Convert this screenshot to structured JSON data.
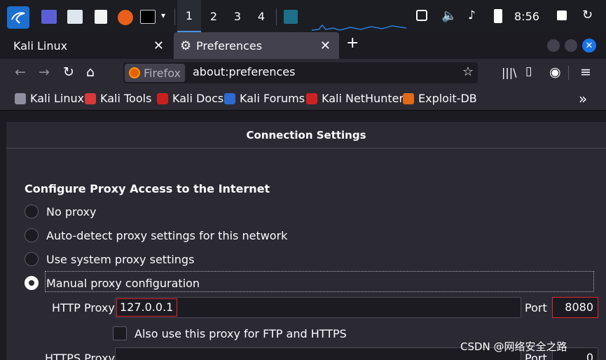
{
  "panel": {
    "workspaces": [
      "1",
      "2",
      "3",
      "4"
    ],
    "active_workspace": "1",
    "clock": "8:56",
    "icons": [
      "kali-menu-icon",
      "desktop-icon",
      "file-manager-icon",
      "text-editor-icon",
      "firefox-icon",
      "terminal-icon",
      "chevron-down-icon",
      "monitor-graph-icon",
      "screen-icon",
      "volume-icon",
      "bell-icon",
      "battery-icon",
      "lock-icon",
      "power-icon"
    ]
  },
  "tabs": [
    {
      "label": "Kali Linux",
      "close": "✕"
    },
    {
      "label": "Preferences",
      "close": "✕"
    }
  ],
  "new_tab": "+",
  "navbar": {
    "identity": "Firefox",
    "url": "about:preferences"
  },
  "bookmarks": [
    {
      "label": "Kali Linux",
      "color": "#8f8f9d"
    },
    {
      "label": "Kali Tools",
      "color": "#d63a3a"
    },
    {
      "label": "Kali Docs",
      "color": "#c82020"
    },
    {
      "label": "Kali Forums",
      "color": "#2d6bd1"
    },
    {
      "label": "Kali NetHunter",
      "color": "#cc2222"
    },
    {
      "label": "Exploit-DB",
      "color": "#e06a1a"
    }
  ],
  "dialog": {
    "title": "Connection Settings",
    "heading": "Configure Proxy Access to the Internet",
    "options": [
      {
        "label": "No proxy",
        "checked": false
      },
      {
        "label": "Auto-detect proxy settings for this network",
        "checked": false
      },
      {
        "label": "Use system proxy settings",
        "checked": false
      },
      {
        "label": "Manual proxy configuration",
        "checked": true
      }
    ],
    "http_proxy_label": "HTTP Proxy",
    "http_proxy_value": "127.0.0.1",
    "port_label": "Port",
    "port_value": "8080",
    "also_use_label": "Also use this proxy for FTP and HTTPS",
    "https_proxy_label": "HTTPS Proxy",
    "https_port_label": "Port",
    "https_port_value": "0"
  },
  "watermark": "CSDN @网络安全之路",
  "colors": {
    "accent": "#1a73e8",
    "highlight": "#e0252a"
  }
}
